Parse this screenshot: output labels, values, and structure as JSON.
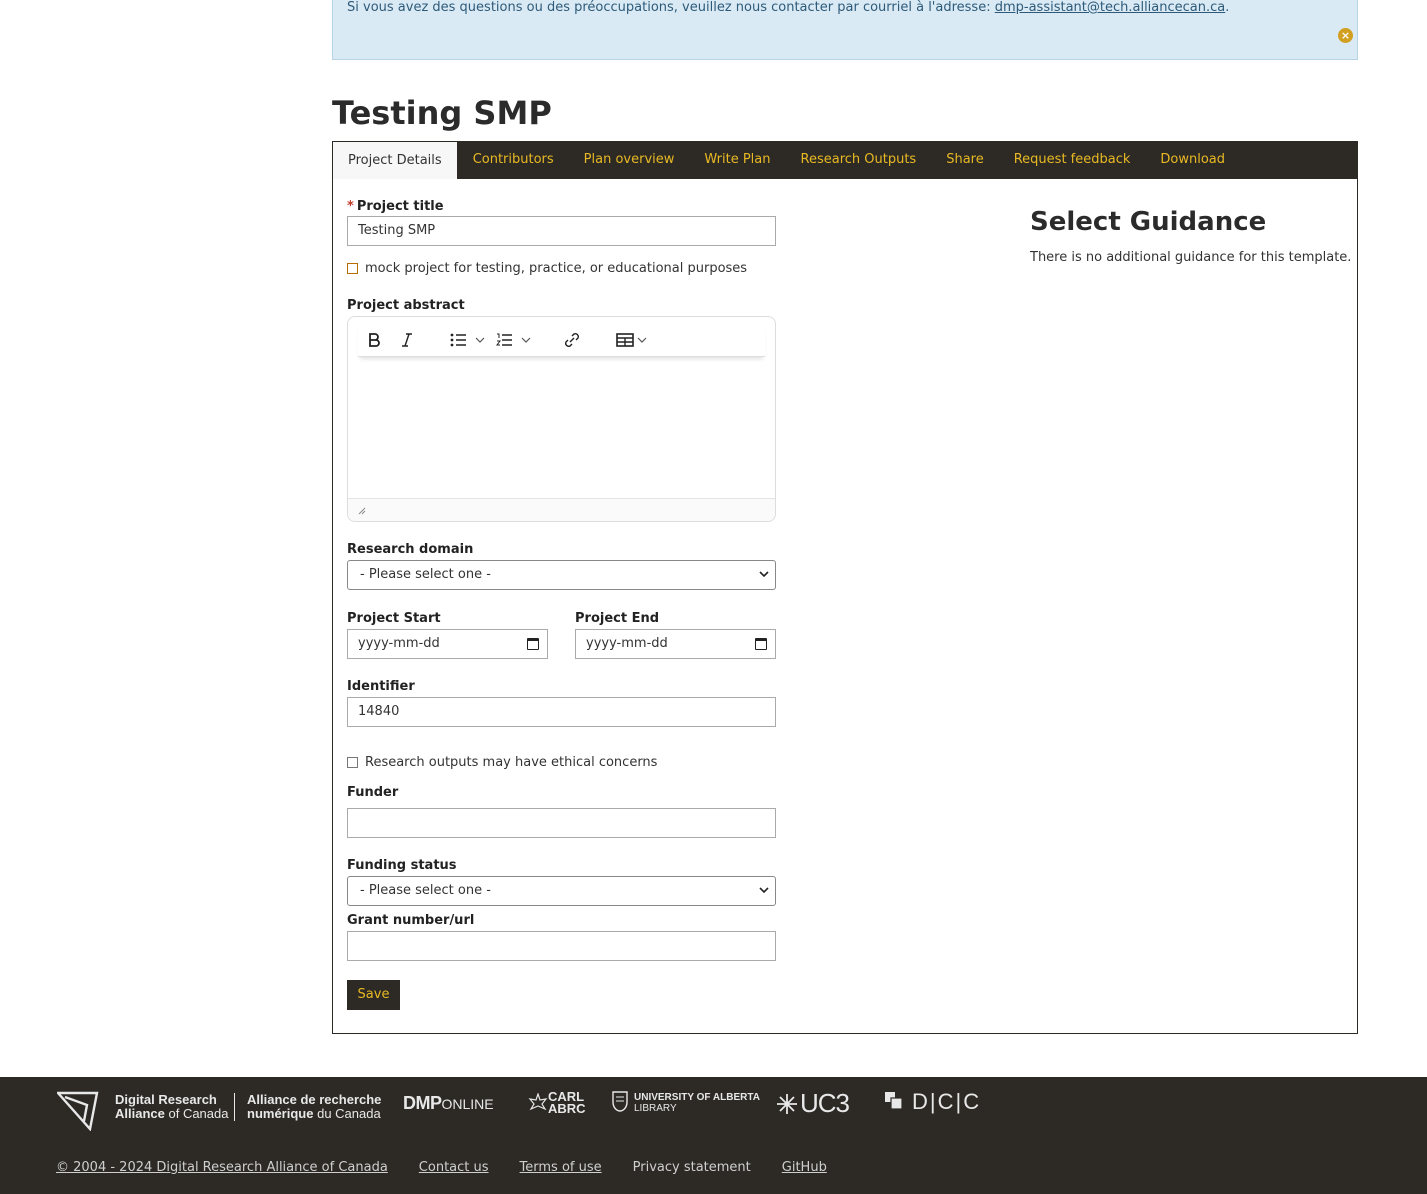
{
  "alert": {
    "message": "Si vous avez des questions ou des préoccupations, veuillez nous contacter par courriel à l'adresse: ",
    "email": "dmp-assistant@tech.alliancecan.ca",
    "trailing": ".",
    "close_icon": "×"
  },
  "page": {
    "title": "Testing SMP"
  },
  "tabs": [
    {
      "label": "Project Details"
    },
    {
      "label": "Contributors"
    },
    {
      "label": "Plan overview"
    },
    {
      "label": "Write Plan"
    },
    {
      "label": "Research Outputs"
    },
    {
      "label": "Share"
    },
    {
      "label": "Request feedback"
    },
    {
      "label": "Download"
    }
  ],
  "form": {
    "required_mark": "*",
    "project_title_label": "Project title",
    "project_title_value": "Testing SMP",
    "mock_project_label": "mock project for testing, practice, or educational purposes",
    "abstract_label": "Project abstract",
    "research_domain_label": "Research domain",
    "research_domain_value": "- Please select one -",
    "project_start_label": "Project Start",
    "project_start_placeholder": "yyyy-mm-dd",
    "project_end_label": "Project End",
    "project_end_placeholder": "yyyy-mm-dd",
    "identifier_label": "Identifier",
    "identifier_value": "14840",
    "ethical_label": "Research outputs may have ethical concerns",
    "funder_label": "Funder",
    "funder_value": "",
    "funding_status_label": "Funding status",
    "funding_status_value": "- Please select one -",
    "grant_label": "Grant number/url",
    "grant_value": "",
    "save_label": "Save"
  },
  "guidance": {
    "title": "Select Guidance",
    "text": "There is no additional guidance for this template."
  },
  "footer": {
    "logos": {
      "alliance_en_1": "Digital Research",
      "alliance_en_2": "Alliance",
      "alliance_en_3": "of Canada",
      "alliance_fr_1": "Alliance de recherche",
      "alliance_fr_2": "numérique",
      "alliance_fr_3": "du Canada",
      "dmp": "DMP",
      "dmp_online": "ONLINE",
      "carl_1": "CARL",
      "carl_2": "ABRC",
      "ualberta_1": "UNIVERSITY OF ALBERTA",
      "ualberta_2": "LIBRARY",
      "uc3": "UC3",
      "dcc": "D|C|C"
    },
    "links": {
      "copyright": "© 2004 - 2024 Digital Research Alliance of Canada",
      "contact": "Contact us",
      "terms": "Terms of use",
      "privacy": "Privacy statement",
      "github": "GitHub"
    }
  }
}
